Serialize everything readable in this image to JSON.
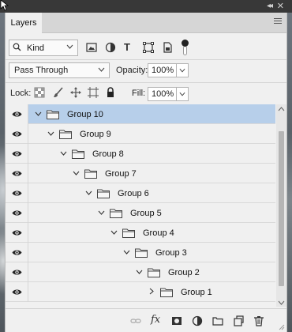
{
  "window": {
    "collapse_glyph": "◂◂",
    "close_glyph": "✕"
  },
  "panel": {
    "tab_label": "Layers",
    "menu_icon": "panel-menu-icon"
  },
  "filter": {
    "kind_label": "Kind",
    "icons": [
      "pixel-filter-icon",
      "adjustment-filter-icon",
      "type-filter-icon",
      "shape-filter-icon",
      "smart-object-filter-icon"
    ],
    "type_glyph": "T"
  },
  "blend": {
    "mode": "Pass Through",
    "opacity_label": "Opacity:",
    "opacity_value": "100%"
  },
  "lock": {
    "label": "Lock:",
    "fill_label": "Fill:",
    "fill_value": "100%"
  },
  "layers": [
    {
      "name": "Group 10",
      "depth": 0,
      "expanded": true,
      "selected": true
    },
    {
      "name": "Group 9",
      "depth": 1,
      "expanded": true,
      "selected": false
    },
    {
      "name": "Group 8",
      "depth": 2,
      "expanded": true,
      "selected": false
    },
    {
      "name": "Group 7",
      "depth": 3,
      "expanded": true,
      "selected": false
    },
    {
      "name": "Group 6",
      "depth": 4,
      "expanded": true,
      "selected": false
    },
    {
      "name": "Group 5",
      "depth": 5,
      "expanded": true,
      "selected": false
    },
    {
      "name": "Group 4",
      "depth": 6,
      "expanded": true,
      "selected": false
    },
    {
      "name": "Group 3",
      "depth": 7,
      "expanded": true,
      "selected": false
    },
    {
      "name": "Group 2",
      "depth": 8,
      "expanded": true,
      "selected": false
    },
    {
      "name": "Group 1",
      "depth": 9,
      "expanded": false,
      "selected": false
    }
  ],
  "bottom": {
    "fx_label": "fx",
    "icons": [
      "link-layers-icon",
      "fx-icon",
      "add-mask-icon",
      "adjustment-layer-icon",
      "new-group-icon",
      "new-layer-icon",
      "delete-icon"
    ]
  },
  "colors": {
    "selected_row": "#b7cfea",
    "panel_bg": "#f0f0f0"
  }
}
